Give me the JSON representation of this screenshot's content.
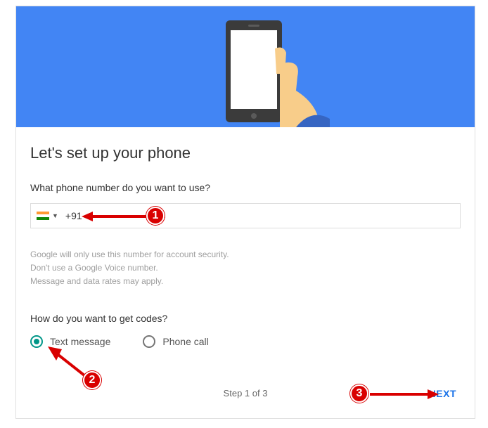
{
  "title": "Let's set up your phone",
  "question_phone": "What phone number do you want to use?",
  "phone": {
    "dial_code": "+91",
    "flag_name": "india-flag",
    "value": ""
  },
  "fineprint": [
    "Google will only use this number for account security.",
    "Don't use a Google Voice number.",
    "Message and data rates may apply."
  ],
  "question_codes": "How do you want to get codes?",
  "radios": {
    "text_message": "Text message",
    "phone_call": "Phone call",
    "selected": "text_message"
  },
  "step_text": "Step 1 of 3",
  "next_label": "NEXT",
  "annotations": {
    "a1": "1",
    "a2": "2",
    "a3": "3"
  }
}
